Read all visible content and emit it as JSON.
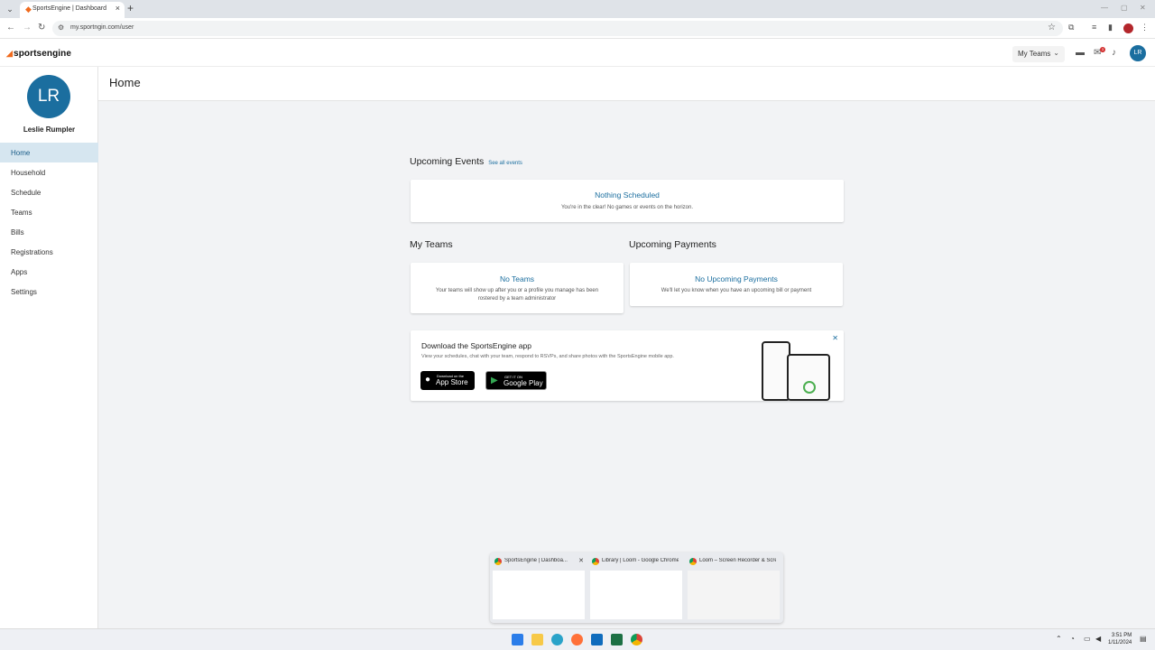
{
  "browser": {
    "tab_title": "SportsEngine | Dashboard",
    "url": "my.sportngin.com/user"
  },
  "header": {
    "logo": "sportsengine",
    "my_teams_label": "My Teams",
    "notification_count": "3",
    "avatar_initials": "LR"
  },
  "sidebar": {
    "avatar_initials": "LR",
    "user_name": "Leslie Rumpler",
    "items": [
      {
        "label": "Home"
      },
      {
        "label": "Household"
      },
      {
        "label": "Schedule"
      },
      {
        "label": "Teams"
      },
      {
        "label": "Bills"
      },
      {
        "label": "Registrations"
      },
      {
        "label": "Apps"
      },
      {
        "label": "Settings"
      }
    ]
  },
  "main": {
    "page_title": "Home",
    "upcoming_events": {
      "heading": "Upcoming Events",
      "link": "See all events",
      "empty_title": "Nothing Scheduled",
      "empty_text": "You're in the clear! No games or events on the horizon."
    },
    "my_teams": {
      "heading": "My Teams",
      "empty_title": "No Teams",
      "empty_text": "Your teams will show up after you or a profile you manage has been rostered by a team administrator"
    },
    "upcoming_payments": {
      "heading": "Upcoming Payments",
      "empty_title": "No Upcoming Payments",
      "empty_text": "We'll let you know when you have an upcoming bill or payment"
    },
    "download": {
      "title": "Download the SportsEngine app",
      "text": "View your schedules, chat with your team, respond to RSVPs, and share photos with the SportsEngine mobile app.",
      "app_store_small": "Download on the",
      "app_store_big": "App Store",
      "google_small": "GET IT ON",
      "google_big": "Google Play"
    }
  },
  "taskbar_preview": [
    {
      "title": "SportsEngine | Dashboa..."
    },
    {
      "title": "Library | Loom - Google Chrome"
    },
    {
      "title": "Loom – Screen Recorder & Scre..."
    }
  ],
  "taskbar": {
    "time": "3:51 PM",
    "date": "1/11/2024"
  },
  "colors": {
    "brand_blue": "#1b6e9f",
    "brand_orange": "#f06a1d",
    "active_nav_bg": "#d6e6f0"
  }
}
